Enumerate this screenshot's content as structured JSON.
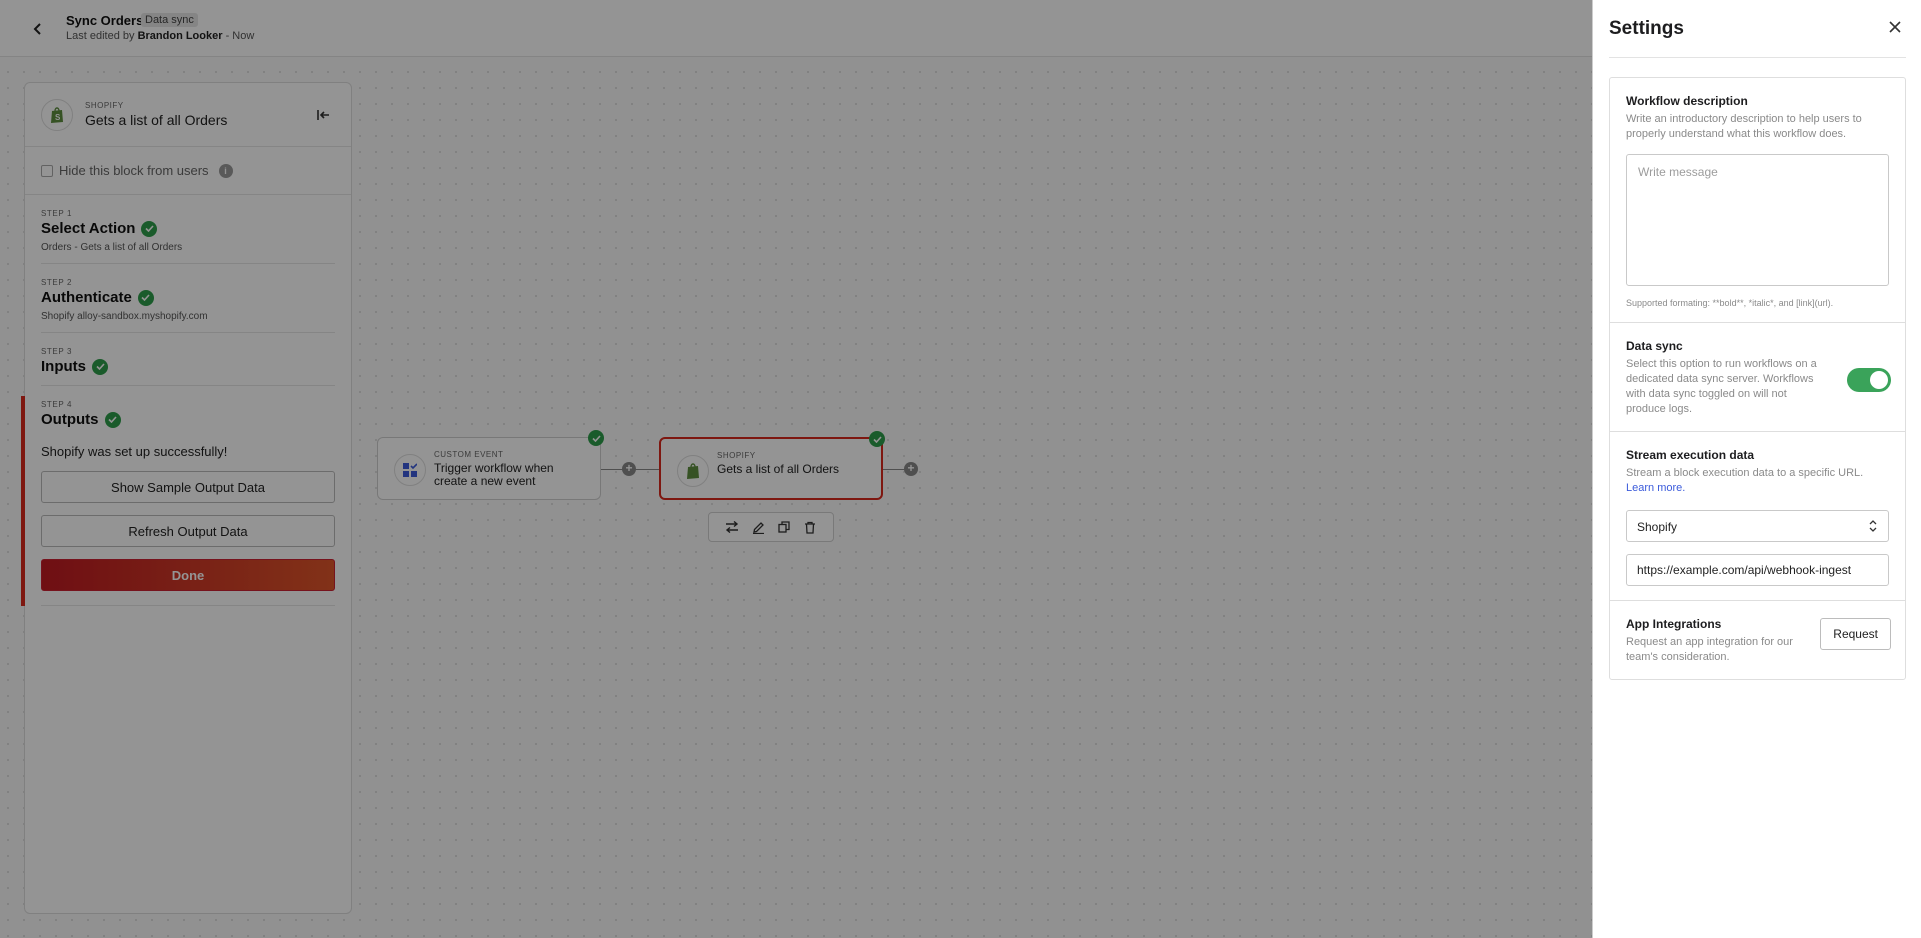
{
  "header": {
    "title": "Sync Orders",
    "badge": "Data sync",
    "edited_prefix": "Last edited by ",
    "edited_user": "Brandon Looker",
    "edited_suffix": " - Now"
  },
  "left_panel": {
    "app_label": "SHOPIFY",
    "app_title": "Gets a list of all Orders",
    "hide_label": "Hide this block from users",
    "steps": [
      {
        "num": "STEP 1",
        "title": "Select Action",
        "sub": "Orders - Gets a list of all Orders"
      },
      {
        "num": "STEP 2",
        "title": "Authenticate",
        "sub": "Shopify alloy-sandbox.myshopify.com"
      },
      {
        "num": "STEP 3",
        "title": "Inputs",
        "sub": ""
      },
      {
        "num": "STEP 4",
        "title": "Outputs",
        "sub": ""
      }
    ],
    "success_text": "Shopify was set up successfully!",
    "show_sample_btn": "Show Sample Output Data",
    "refresh_btn": "Refresh Output Data",
    "done_btn": "Done"
  },
  "canvas": {
    "node1": {
      "label": "CUSTOM EVENT",
      "title": "Trigger workflow when create a new event"
    },
    "node2": {
      "label": "SHOPIFY",
      "title": "Gets a list of all Orders"
    }
  },
  "settings": {
    "title": "Settings",
    "workflow_description": {
      "title": "Workflow description",
      "desc": "Write an introductory description to help users to properly understand what this workflow does.",
      "placeholder": "Write message",
      "hint": "Supported formating: **bold**, *italic*, and [link](url)."
    },
    "data_sync": {
      "title": "Data sync",
      "desc": "Select this option to run workflows on a dedicated data sync server. Workflows with data sync toggled on will not produce logs.",
      "enabled": true
    },
    "stream": {
      "title": "Stream execution data",
      "desc": "Stream a block execution data to a specific URL.",
      "link": "Learn more.",
      "select_value": "Shopify",
      "url_value": "https://example.com/api/webhook-ingest"
    },
    "app_integrations": {
      "title": "App Integrations",
      "desc": "Request an app integration for our team's consideration.",
      "button": "Request"
    }
  },
  "colors": {
    "accent_green": "#3aa35a",
    "brand_red": "#d9281c",
    "link_blue": "#3b5bdb"
  }
}
